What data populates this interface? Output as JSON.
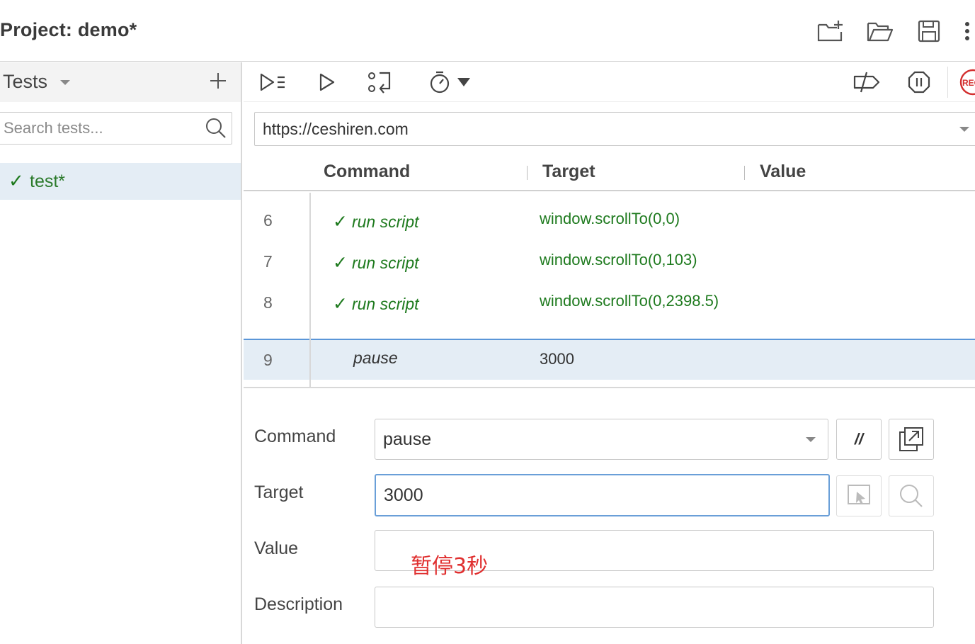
{
  "header": {
    "project_title": "Project:  demo*",
    "icons": [
      "new-project-icon",
      "open-project-icon",
      "save-project-icon",
      "more-options-icon"
    ]
  },
  "sidebar": {
    "section_label": "Tests",
    "search_placeholder": "Search tests...",
    "tests": [
      {
        "name": "test*",
        "status": "passed"
      }
    ]
  },
  "toolbar": {
    "icons": [
      "run-all-tests-icon",
      "run-current-test-icon",
      "step-over-icon",
      "test-speed-icon",
      "disable-breakpoints-icon",
      "pause-on-exceptions-icon",
      "record-icon"
    ],
    "record_label": "REC"
  },
  "url": "https://ceshiren.com",
  "grid": {
    "columns": [
      "Command",
      "Target",
      "Value"
    ],
    "rows": [
      {
        "num": "6",
        "command": "run script",
        "target": "window.scrollTo(0,0)",
        "value": "",
        "status": "passed"
      },
      {
        "num": "7",
        "command": "run script",
        "target": "window.scrollTo(0,103)",
        "value": "",
        "status": "passed"
      },
      {
        "num": "8",
        "command": "run script",
        "target": "window.scrollTo(0,2398.5)",
        "value": "",
        "status": "passed"
      },
      {
        "num": "9",
        "command": "pause",
        "target": "3000",
        "value": "",
        "status": "selected"
      }
    ]
  },
  "editor": {
    "command_label": "Command",
    "command_value": "pause",
    "comment_button": "//",
    "target_label": "Target",
    "target_value": "3000",
    "value_label": "Value",
    "value_value": "",
    "description_label": "Description",
    "description_value": ""
  },
  "annotation": "暂停3秒",
  "colors": {
    "passed": "#1e7a1e",
    "selected_bg": "#e4edf5",
    "selected_border": "#5b96d8",
    "record": "#d32f2f",
    "annotation": "#e03030"
  }
}
